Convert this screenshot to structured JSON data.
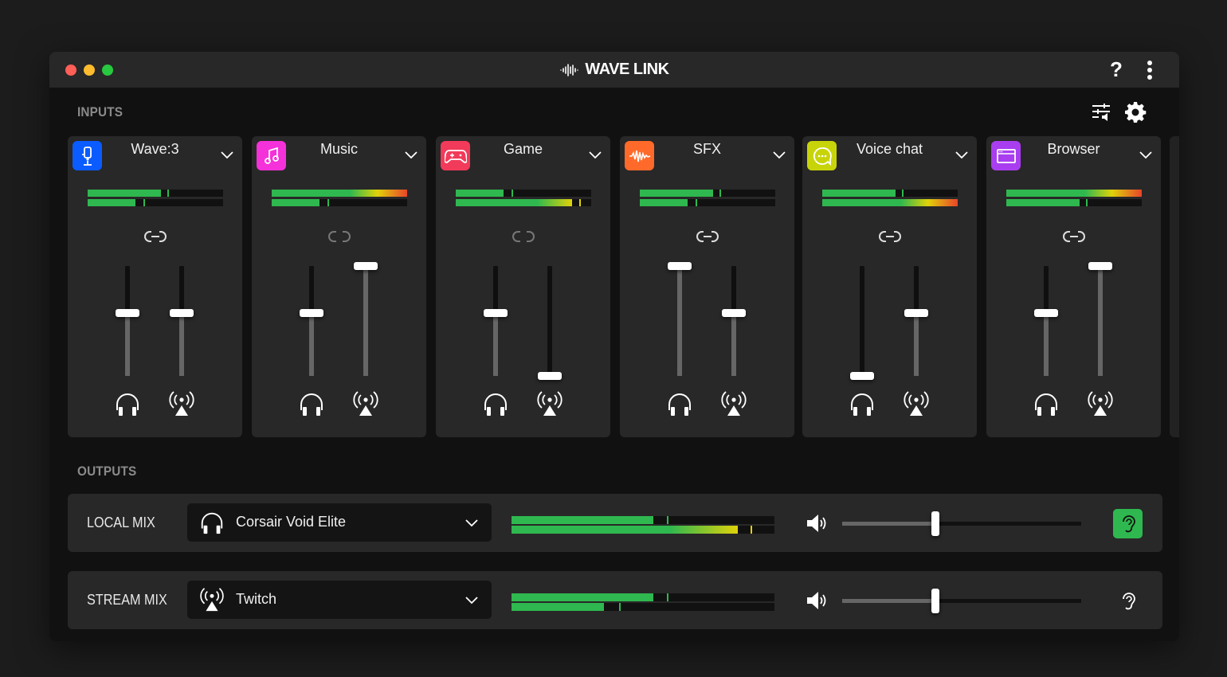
{
  "app": {
    "title": "WAVE LINK",
    "help_label": "?",
    "window_controls": [
      "close",
      "minimize",
      "maximize"
    ]
  },
  "colors": {
    "meter_green": "#2fb84f",
    "meter_yellow": "#e0d20a",
    "meter_red": "#e8452a",
    "monitor_active": "#2fb84f"
  },
  "inputs": {
    "label": "INPUTS",
    "toolbar": [
      {
        "icon": "mixer-settings-icon"
      },
      {
        "icon": "gear-icon"
      }
    ],
    "channels": [
      {
        "name": "Wave:3",
        "icon": "microphone-icon",
        "color": "#0a5cff",
        "linked": true,
        "meters": [
          {
            "level": 0.54,
            "peak": 0.59
          },
          {
            "level": 0.35,
            "peak": 0.41
          }
        ],
        "local_volume": 0.57,
        "stream_volume": 0.57
      },
      {
        "name": "Music",
        "icon": "music-note-icon",
        "color": "#f531d9",
        "linked": false,
        "meters": [
          {
            "level": 1.0,
            "peak": null
          },
          {
            "level": 0.35,
            "peak": 0.41
          }
        ],
        "local_volume": 0.57,
        "stream_volume": 1.0
      },
      {
        "name": "Game",
        "icon": "gamepad-icon",
        "color": "#f23a5a",
        "linked": false,
        "meters": [
          {
            "level": 0.35,
            "peak": 0.41
          },
          {
            "level": 0.86,
            "peak": 0.91
          }
        ],
        "local_volume": 0.57,
        "stream_volume": 0.0
      },
      {
        "name": "SFX",
        "icon": "waveform-icon",
        "color": "#ff6a2a",
        "linked": true,
        "meters": [
          {
            "level": 0.54,
            "peak": 0.59
          },
          {
            "level": 0.35,
            "peak": 0.41
          }
        ],
        "local_volume": 1.0,
        "stream_volume": 0.57
      },
      {
        "name": "Voice chat",
        "icon": "chat-bubble-icon",
        "color": "#c8d40a",
        "linked": true,
        "meters": [
          {
            "level": 0.54,
            "peak": 0.59
          },
          {
            "level": 1.0,
            "peak": null
          }
        ],
        "local_volume": 0.0,
        "stream_volume": 0.57
      },
      {
        "name": "Browser",
        "icon": "browser-window-icon",
        "color": "#a93ef0",
        "linked": true,
        "meters": [
          {
            "level": 1.0,
            "peak": null
          },
          {
            "level": 0.54,
            "peak": 0.59
          }
        ],
        "local_volume": 0.57,
        "stream_volume": 1.0
      }
    ]
  },
  "outputs": {
    "label": "OUTPUTS",
    "mixes": [
      {
        "name": "LOCAL MIX",
        "device": "Corsair Void Elite",
        "device_icon": "headphones-icon",
        "meters": [
          {
            "level": 0.54,
            "peak": 0.59
          },
          {
            "level": 0.86,
            "peak": 0.91
          }
        ],
        "volume": 0.39,
        "monitoring": true
      },
      {
        "name": "STREAM MIX",
        "device": "Twitch",
        "device_icon": "broadcast-icon",
        "meters": [
          {
            "level": 0.54,
            "peak": 0.59
          },
          {
            "level": 0.35,
            "peak": 0.41
          }
        ],
        "volume": 0.39,
        "monitoring": false
      }
    ]
  }
}
